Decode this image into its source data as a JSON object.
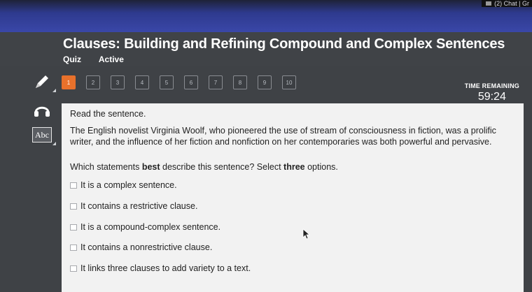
{
  "browser": {
    "chat_tab": "(2) Chat | Gr"
  },
  "quiz": {
    "title": "Clauses: Building and Refining Compound and Complex Sentences",
    "type_label": "Quiz",
    "status_label": "Active"
  },
  "nav": {
    "current": 1,
    "questions": [
      "1",
      "2",
      "3",
      "4",
      "5",
      "6",
      "7",
      "8",
      "9",
      "10"
    ]
  },
  "timer": {
    "label": "TIME REMAINING",
    "value": "59:24"
  },
  "tools": {
    "pencil": "pencil-icon",
    "audio": "headphones-icon",
    "dictionary": "dictionary-icon",
    "dictionary_text": "Abc"
  },
  "question": {
    "instruction": "Read the sentence.",
    "passage_line1": "The English novelist Virginia Woolf, who pioneered the use of stream of consciousness in fiction, was a prolific",
    "passage_line2": "writer, and the influence of her fiction and nonfiction on her contemporaries was both powerful and pervasive.",
    "prompt_before": "Which statements ",
    "prompt_bold1": "best",
    "prompt_middle": " describe this sentence? Select ",
    "prompt_bold2": "three",
    "prompt_after": " options.",
    "options": [
      "It is a complex sentence.",
      "It contains a restrictive clause.",
      "It is a compound-complex sentence.",
      "It contains a nonrestrictive clause.",
      "It links three clauses to add variety to a text."
    ]
  },
  "colors": {
    "accent": "#e8712b",
    "header_blue": "#3a47a8",
    "panel": "#f2f2f2"
  }
}
